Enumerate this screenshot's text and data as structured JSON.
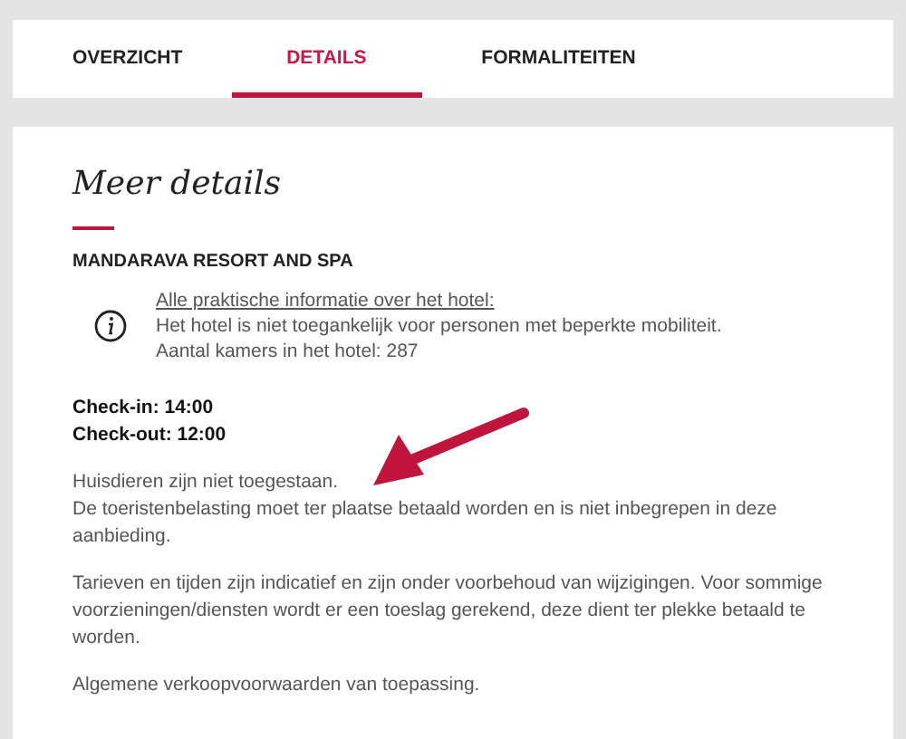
{
  "tabs": [
    {
      "label": "OVERZICHT",
      "selected": false
    },
    {
      "label": "DETAILS",
      "selected": true
    },
    {
      "label": "FORMALITEITEN",
      "selected": false
    }
  ],
  "section": {
    "title": "Meer details",
    "hotel_name": "MANDARAVA RESORT AND SPA",
    "info": {
      "link": "Alle praktische informatie over het hotel:",
      "lines": [
        "Het hotel is niet toegankelijk voor personen met beperkte mobiliteit.",
        "Aantal kamers in het hotel: 287"
      ]
    },
    "times": [
      "Check-in: 14:00",
      "Check-out: 12:00"
    ],
    "paragraphs": [
      [
        "Huisdieren zijn niet toegestaan.",
        "De toeristenbelasting moet ter plaatse betaald worden en is niet inbegrepen in deze aanbieding."
      ],
      [
        "Tarieven en tijden zijn indicatief en zijn onder voorbehoud van wijzigingen. Voor sommige voorzieningen/diensten wordt er een toeslag gerekend, deze dient ter plekke betaald te worden."
      ],
      [
        "Algemene verkoopvoorwaarden van toepassing."
      ]
    ]
  }
}
